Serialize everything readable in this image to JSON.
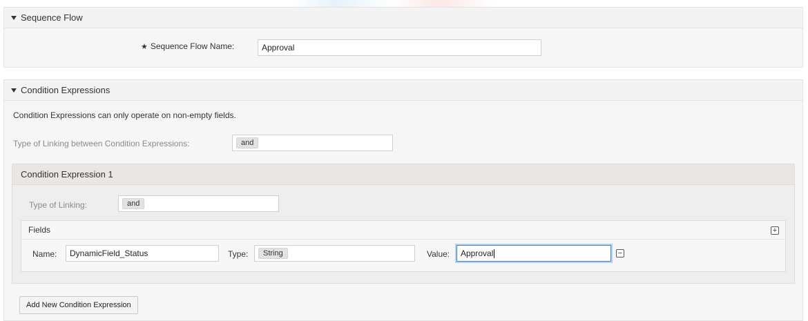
{
  "sequence_flow": {
    "header": "Sequence Flow",
    "name_label": "Sequence Flow Name:",
    "name_required_mark": "★",
    "name_value": "Approval"
  },
  "condition_expressions": {
    "header": "Condition Expressions",
    "note": "Condition Expressions can only operate on non-empty fields.",
    "linking_label": "Type of Linking between Condition Expressions:",
    "linking_value": "and",
    "expression": {
      "header": "Condition Expression 1",
      "linking_label": "Type of Linking:",
      "linking_value": "and",
      "fields": {
        "header": "Fields",
        "add_icon": "plus-square-icon",
        "remove_icon": "minus-square-icon",
        "name_label": "Name:",
        "name_value": "DynamicField_Status",
        "type_label": "Type:",
        "type_value": "String",
        "value_label": "Value:",
        "value_value": "Approval"
      }
    },
    "add_button": "Add New Condition Expression"
  },
  "colors": {
    "panel_bg": "#f6f6f6",
    "focus_border": "#3f86d8"
  }
}
